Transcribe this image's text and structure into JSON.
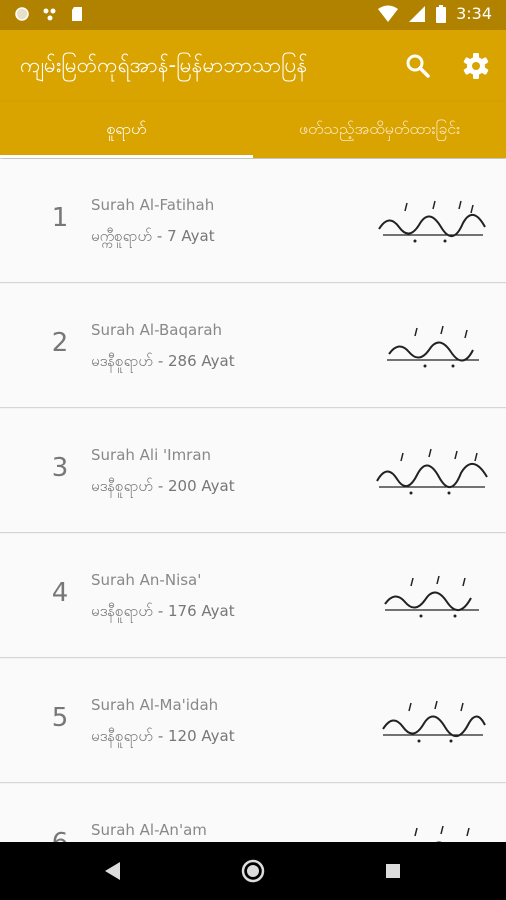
{
  "status_bar": {
    "time": "3:34"
  },
  "app_bar": {
    "title": "ကျမ်းမြတ်ကုရ်အာန်-မြန်မာဘာသာပြန်"
  },
  "tabs": [
    {
      "label": "စူရာဟ်",
      "active": true
    },
    {
      "label": "ဖတ်သည့်အထိမှတ်ထားခြင်း",
      "active": false
    }
  ],
  "surahs": [
    {
      "number": "1",
      "name": "Surah Al-Fatihah",
      "desc": "မက္ကီစူရာဟ် - 7 Ayat"
    },
    {
      "number": "2",
      "name": "Surah Al-Baqarah",
      "desc": "မဒနီစူရာဟ် - 286 Ayat"
    },
    {
      "number": "3",
      "name": "Surah Ali 'Imran",
      "desc": "မဒနီစူရာဟ် - 200 Ayat"
    },
    {
      "number": "4",
      "name": "Surah An-Nisa'",
      "desc": "မဒနီစူရာဟ် - 176 Ayat"
    },
    {
      "number": "5",
      "name": "Surah Al-Ma'idah",
      "desc": "မဒနီစူရာဟ် - 120 Ayat"
    },
    {
      "number": "6",
      "name": "Surah Al-An'am",
      "desc": ""
    }
  ],
  "colors": {
    "primary": "#d9a300",
    "status_bar": "#b08200",
    "list_bg": "#fafafa"
  },
  "icons": {
    "search": "search-icon",
    "settings": "gear-icon",
    "back": "back-triangle-icon",
    "home": "home-circle-icon",
    "recents": "recents-square-icon"
  }
}
